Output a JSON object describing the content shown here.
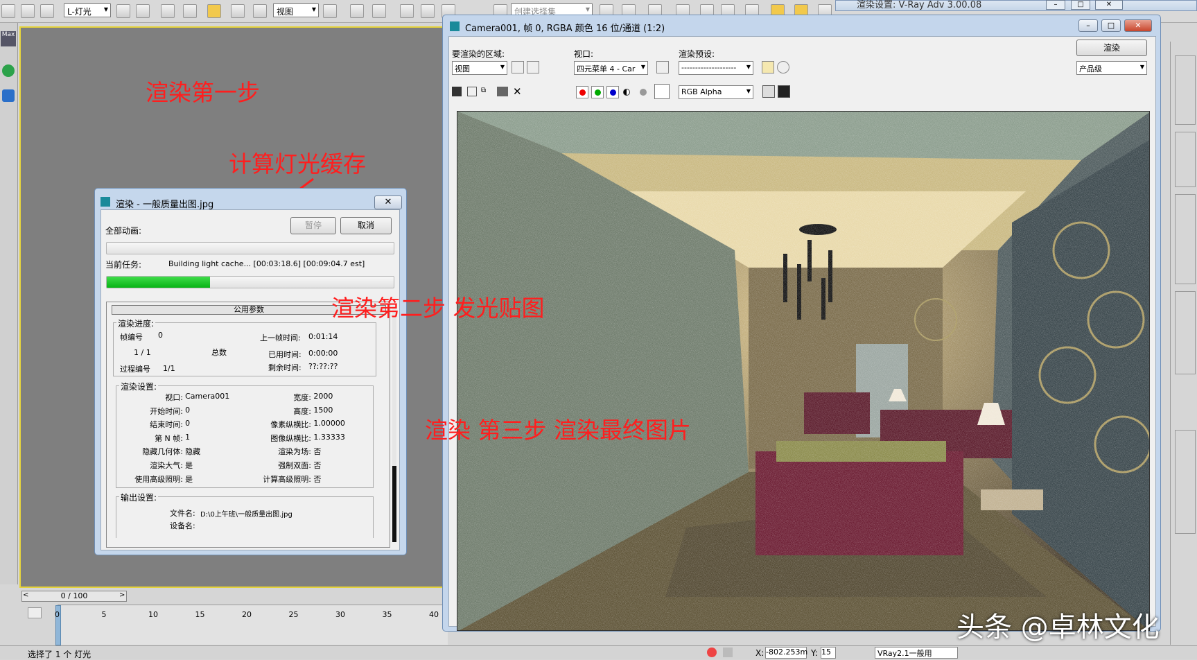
{
  "toolbar": {
    "layer_select": "L-灯光",
    "view_select": "视图",
    "named_sel_placeholder": "创建选择集"
  },
  "vray_settings_title": "渲染设置: V-Ray Adv 3.00.08",
  "annotations": {
    "step1": "渲染第一步",
    "light_cache": "计算灯光缓存",
    "step2": "渲染第二步 发光贴图",
    "step3": "渲染 第三步  渲染最终图片"
  },
  "timeline": {
    "slider": "0 / 100",
    "ticks": [
      "0",
      "5",
      "10",
      "15",
      "20",
      "25",
      "30",
      "35",
      "40"
    ]
  },
  "status": {
    "selection": "选择了 1 个 灯光",
    "x_coord": "-802.253m",
    "y_label": "Y:",
    "y_coord": "15",
    "x_label": "X:",
    "bottom_select": "VRay2.1一般用"
  },
  "progress_dialog": {
    "title": "渲染 - 一般质量出图.jpg",
    "all_anim_label": "全部动画:",
    "pause_btn": "暂停",
    "cancel_btn": "取消",
    "current_task_label": "当前任务:",
    "current_task": "Building light cache... [00:03:18.6] [00:09:04.7 est]",
    "task_progress": 0.36,
    "common_params": "公用参数",
    "progress_group": "渲染进度:",
    "frame_num_label": "帧编号",
    "frame_num": "0",
    "frames": "1  /  1",
    "total_label": "总数",
    "pass_label": "过程编号",
    "pass": "1/1",
    "last_frame_label": "上一帧时间:",
    "last_frame": "0:01:14",
    "elapsed_label": "已用时间:",
    "elapsed": "0:00:00",
    "remaining_label": "剩余时间:",
    "remaining": "??:??:??",
    "settings_group": "渲染设置:",
    "settings_left": [
      {
        "k": "视口:",
        "v": "Camera001"
      },
      {
        "k": "开始时间:",
        "v": "0"
      },
      {
        "k": "结束时间:",
        "v": "0"
      },
      {
        "k": "第 N 帧:",
        "v": "1"
      },
      {
        "k": "隐藏几何体:",
        "v": "隐藏"
      },
      {
        "k": "渲染大气:",
        "v": "是"
      },
      {
        "k": "使用高级照明:",
        "v": "是"
      }
    ],
    "settings_right": [
      {
        "k": "宽度:",
        "v": "2000"
      },
      {
        "k": "高度:",
        "v": "1500"
      },
      {
        "k": "像素纵横比:",
        "v": "1.00000"
      },
      {
        "k": "图像纵横比:",
        "v": "1.33333"
      },
      {
        "k": "渲染为场:",
        "v": "否"
      },
      {
        "k": "强制双面:",
        "v": "否"
      },
      {
        "k": "计算高级照明:",
        "v": "否"
      }
    ],
    "output_group": "输出设置:",
    "file_label": "文件名:",
    "file": "D:\\0上午班\\一般质量出图.jpg",
    "device_label": "设备名:"
  },
  "frame_buffer": {
    "title": "Camera001, 帧 0, RGBA 颜色 16 位/通道 (1:2)",
    "area_label": "要渲染的区域:",
    "area_value": "视图",
    "viewport_label": "视口:",
    "viewport_value": "四元菜单 4 - Car",
    "preset_label": "渲染预设:",
    "preset_value": "--------------------",
    "render_btn": "渲染",
    "quality_value": "产品级",
    "channel_value": "RGB Alpha"
  },
  "watermark": "头条 @卓林文化",
  "colors": {
    "accent_border": "#e5d33c",
    "annotation": "#ff1e1e",
    "progress": "#08b315"
  }
}
